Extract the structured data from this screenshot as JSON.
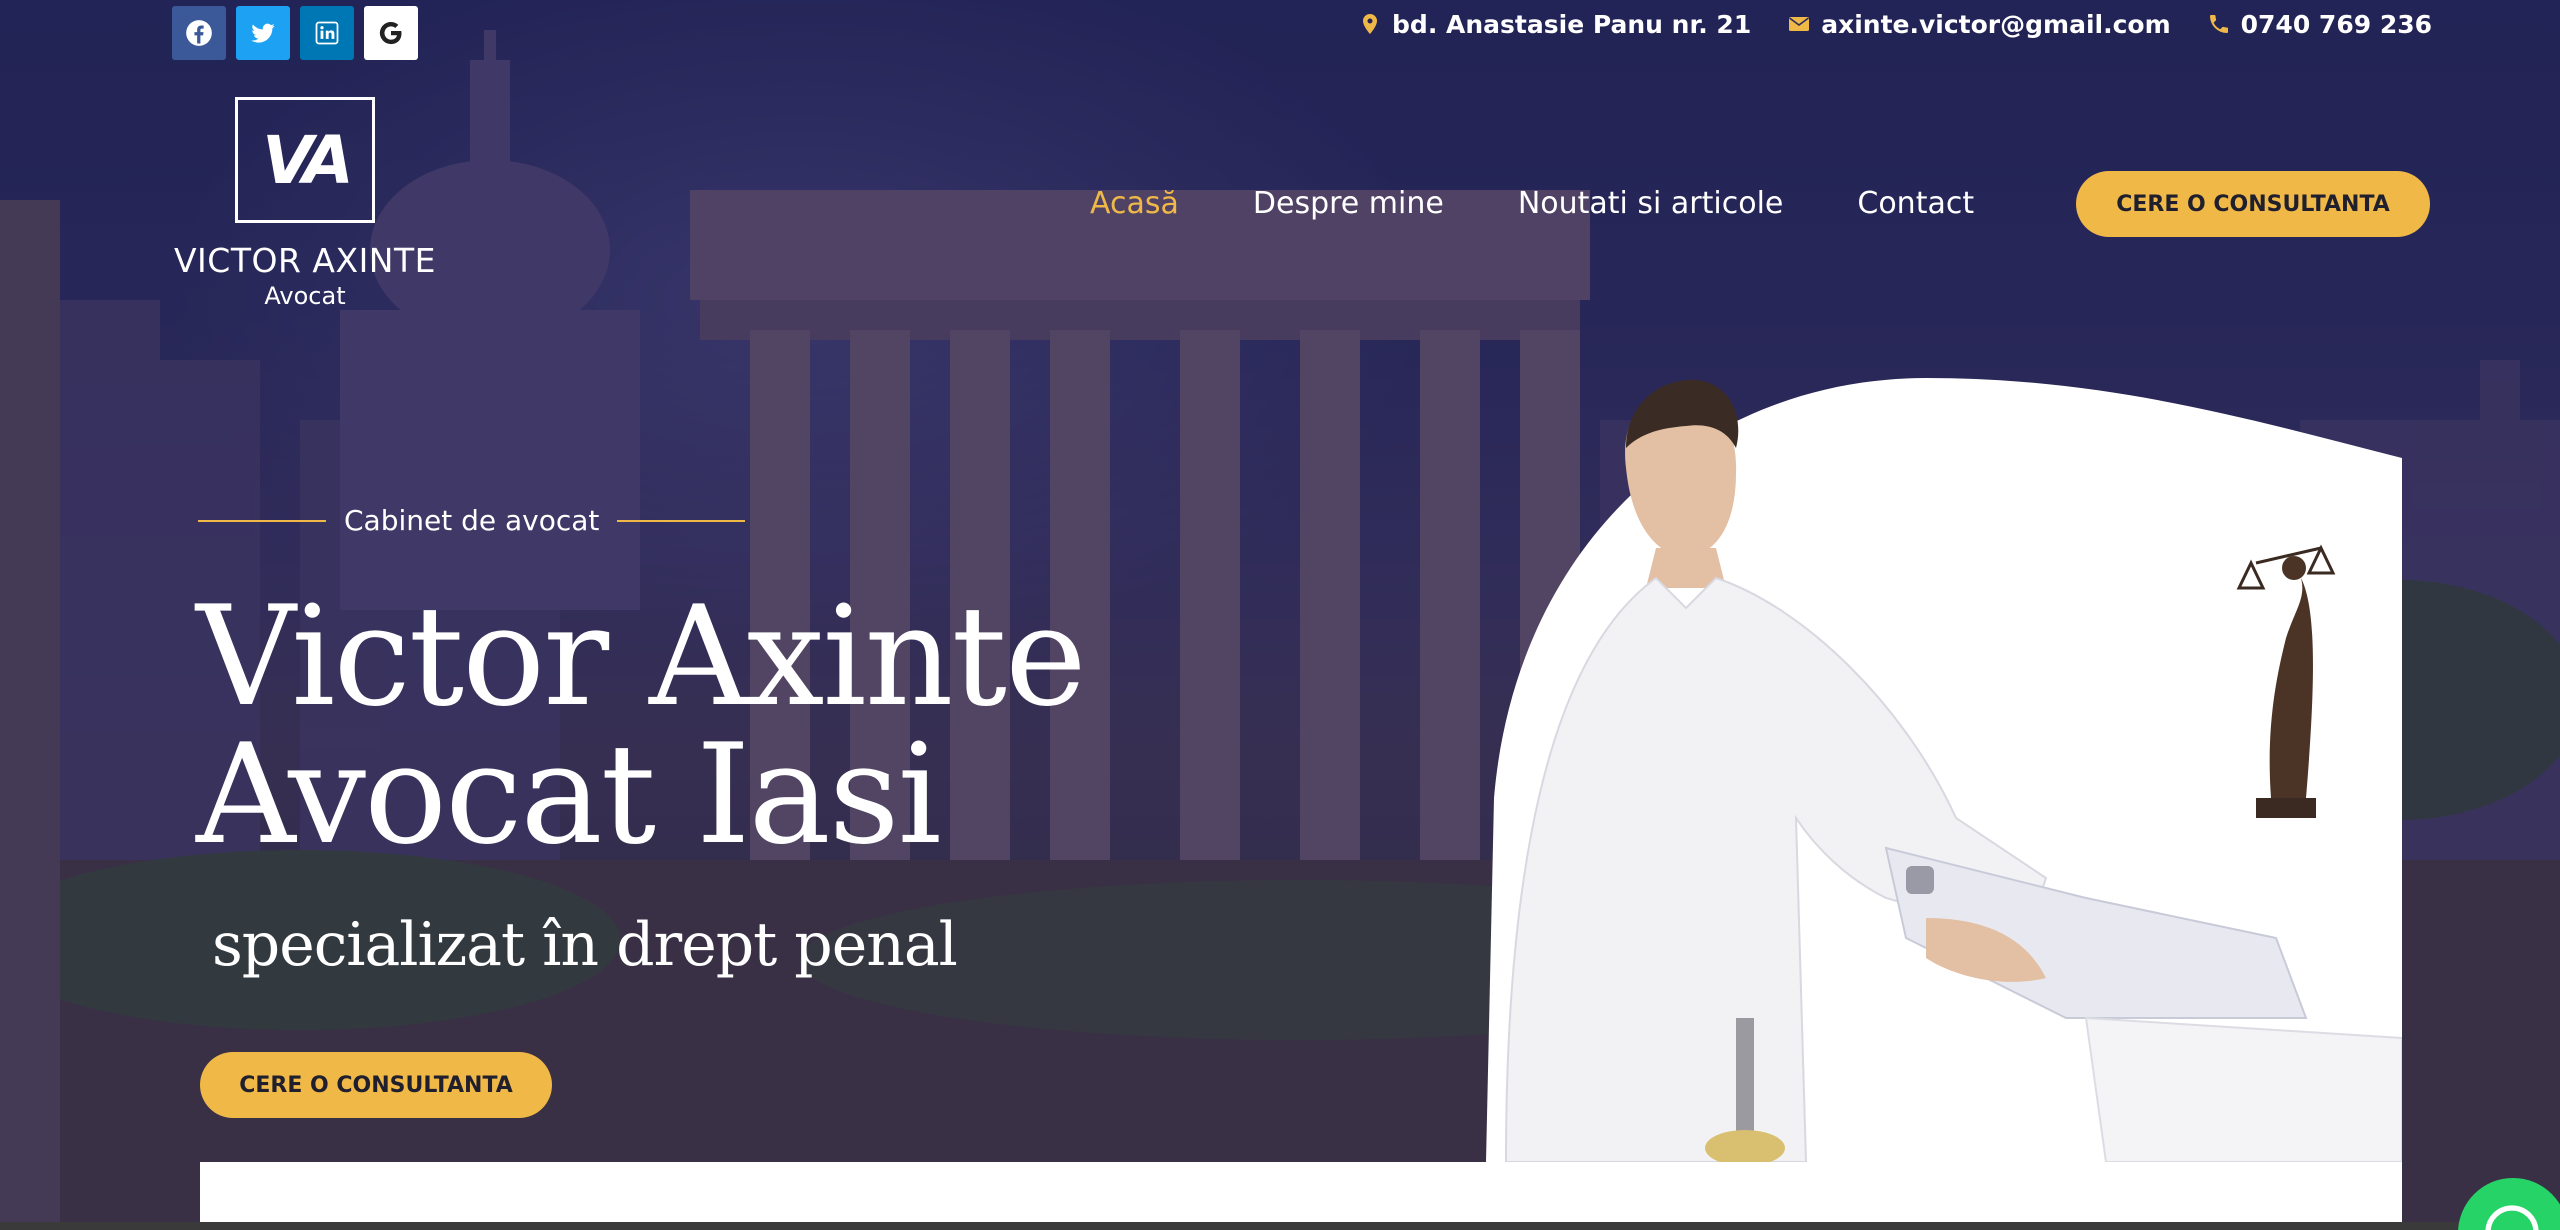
{
  "topbar": {
    "social": [
      {
        "name": "facebook-icon",
        "color": "#3b5998"
      },
      {
        "name": "twitter-icon",
        "color": "#1da1f2"
      },
      {
        "name": "linkedin-icon",
        "color": "#0077b5"
      },
      {
        "name": "google-icon",
        "color": "#ffffff"
      }
    ],
    "address": "bd. Anastasie Panu nr. 21",
    "email": "axinte.victor@gmail.com",
    "phone": "0740 769 236"
  },
  "logo": {
    "monogram": "VA",
    "name": "VICTOR AXINTE",
    "subtitle": "Avocat"
  },
  "nav": {
    "items": [
      {
        "label": "Acasă",
        "active": true
      },
      {
        "label": "Despre mine",
        "active": false
      },
      {
        "label": "Noutati si articole",
        "active": false
      },
      {
        "label": "Contact",
        "active": false
      }
    ],
    "cta": "CERE O CONSULTANTA"
  },
  "hero": {
    "eyebrow": "Cabinet de avocat",
    "title_line1": "Victor Axinte",
    "title_line2": "Avocat Iasi",
    "subtitle": "specializat în drept penal",
    "cta": "CERE O CONSULTANTA"
  },
  "colors": {
    "accent": "#f0b847",
    "overlay": "#1e1e50",
    "whatsapp": "#25d366"
  }
}
